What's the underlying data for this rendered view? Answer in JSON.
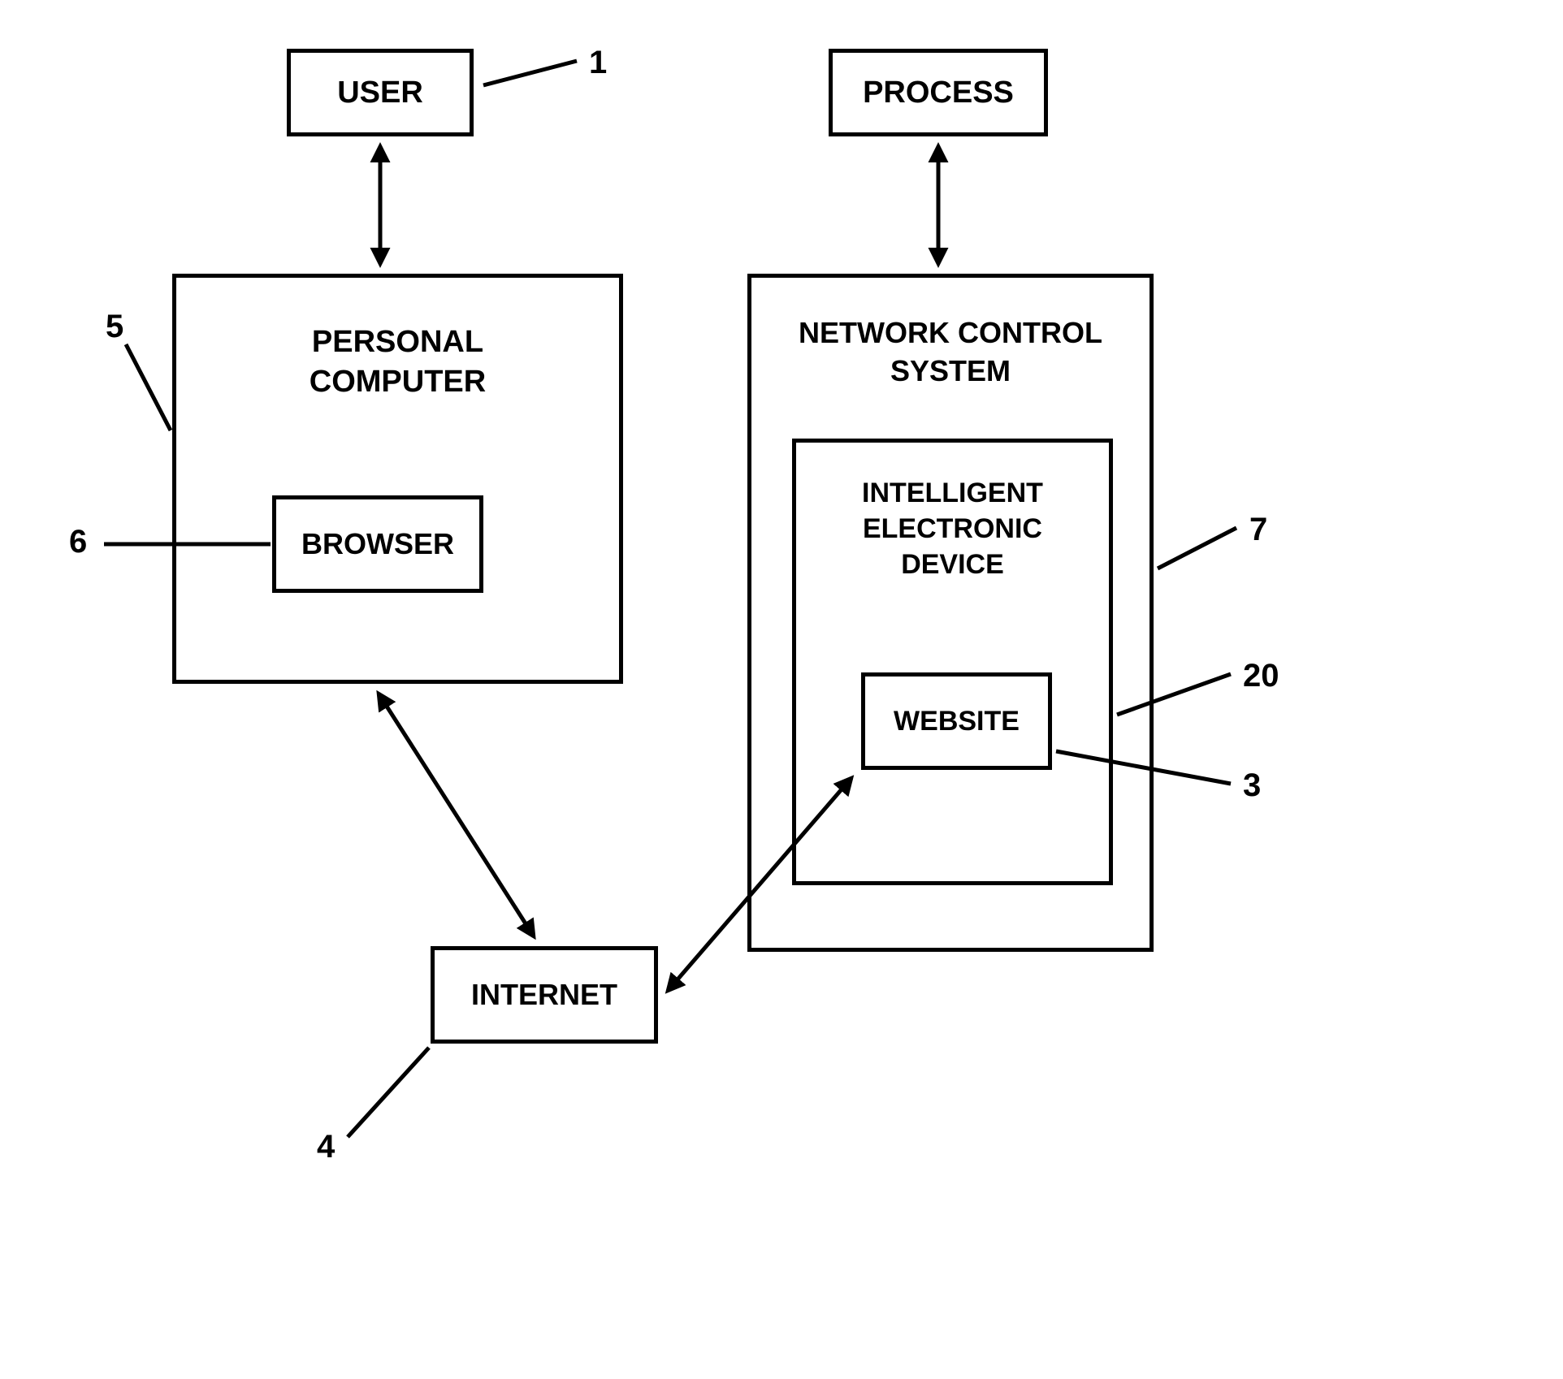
{
  "boxes": {
    "user": "USER",
    "process": "PROCESS",
    "personalComputer": "PERSONAL\nCOMPUTER",
    "browser": "BROWSER",
    "networkControl": "NETWORK CONTROL\nSYSTEM",
    "ied": "INTELLIGENT\nELECTRONIC\nDEVICE",
    "website": "WEBSITE",
    "internet": "INTERNET"
  },
  "labels": {
    "l1": "1",
    "l5": "5",
    "l6": "6",
    "l4": "4",
    "l7": "7",
    "l20": "20",
    "l3": "3"
  }
}
